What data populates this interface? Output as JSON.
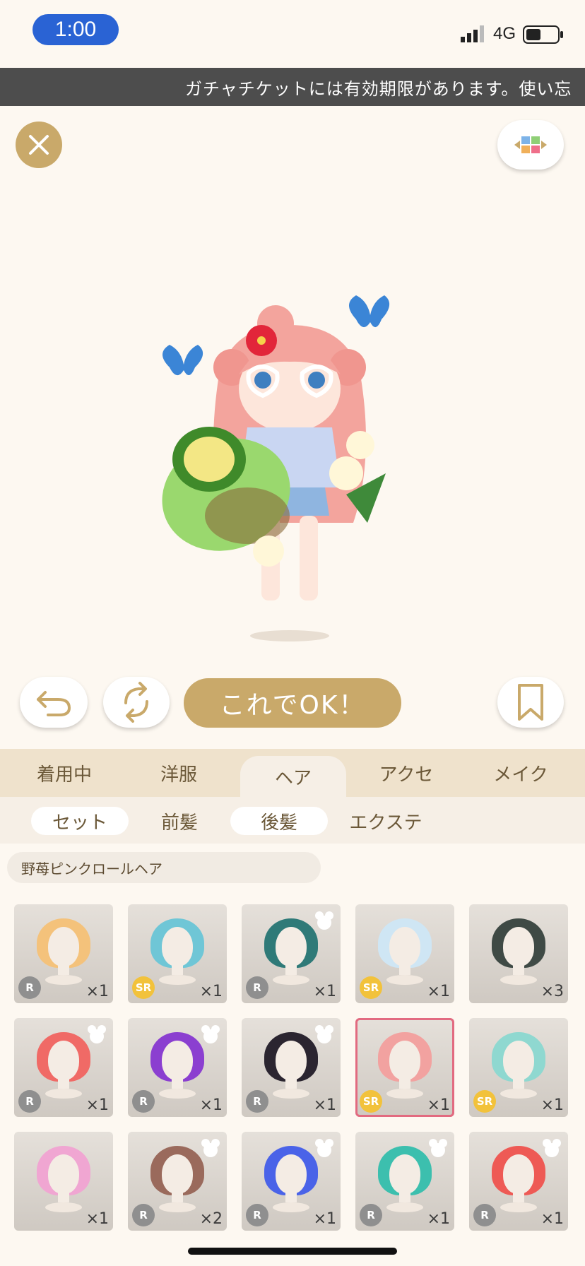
{
  "status": {
    "time": "1:00",
    "network": "4G"
  },
  "banner": {
    "text": "ガチャチケットには有効期限があります。使い忘"
  },
  "actions": {
    "ok_label": "これでOK！"
  },
  "tabs": [
    {
      "label": "着用中"
    },
    {
      "label": "洋服"
    },
    {
      "label": "ヘア"
    },
    {
      "label": "アクセ"
    },
    {
      "label": "メイク"
    }
  ],
  "subtabs": [
    {
      "label": "セット"
    },
    {
      "label": "前髪"
    },
    {
      "label": "後髪"
    },
    {
      "label": "エクステ"
    }
  ],
  "selected_item_name": "野苺ピンクロールヘア",
  "items": [
    {
      "rarity": "R",
      "qty": "×1",
      "hair": "#f4c27b"
    },
    {
      "rarity": "SR",
      "qty": "×1",
      "hair": "#6fc6d6"
    },
    {
      "rarity": "R",
      "qty": "×1",
      "hair": "#2f7a78"
    },
    {
      "rarity": "SR",
      "qty": "×1",
      "hair": "#cfe6f4"
    },
    {
      "rarity": "",
      "qty": "×3",
      "hair": "#3f4a45"
    },
    {
      "rarity": "R",
      "qty": "×1",
      "hair": "#f06a66"
    },
    {
      "rarity": "R",
      "qty": "×1",
      "hair": "#8b3fd0"
    },
    {
      "rarity": "R",
      "qty": "×1",
      "hair": "#2b2530"
    },
    {
      "rarity": "SR",
      "qty": "×1",
      "hair": "#f2a2a0"
    },
    {
      "rarity": "SR",
      "qty": "×1",
      "hair": "#8fd8d0"
    },
    {
      "rarity": "",
      "qty": "×1",
      "hair": "#f0a6d2"
    },
    {
      "rarity": "R",
      "qty": "×2",
      "hair": "#9a6a5c"
    },
    {
      "rarity": "R",
      "qty": "×1",
      "hair": "#4a63e8"
    },
    {
      "rarity": "R",
      "qty": "×1",
      "hair": "#3cbfae"
    },
    {
      "rarity": "R",
      "qty": "×1",
      "hair": "#ee5a55"
    }
  ],
  "colors": {
    "accent": "#c9a96a",
    "r_badge": "#8f8f8f",
    "sr_badge": "#f2c23b",
    "selected_border": "#e26a80"
  }
}
